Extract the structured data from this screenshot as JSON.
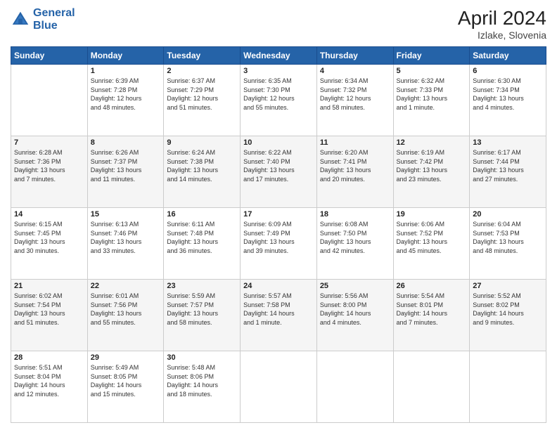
{
  "header": {
    "logo_line1": "General",
    "logo_line2": "Blue",
    "month_year": "April 2024",
    "location": "Izlake, Slovenia"
  },
  "weekdays": [
    "Sunday",
    "Monday",
    "Tuesday",
    "Wednesday",
    "Thursday",
    "Friday",
    "Saturday"
  ],
  "weeks": [
    [
      {
        "day": "",
        "info": ""
      },
      {
        "day": "1",
        "info": "Sunrise: 6:39 AM\nSunset: 7:28 PM\nDaylight: 12 hours\nand 48 minutes."
      },
      {
        "day": "2",
        "info": "Sunrise: 6:37 AM\nSunset: 7:29 PM\nDaylight: 12 hours\nand 51 minutes."
      },
      {
        "day": "3",
        "info": "Sunrise: 6:35 AM\nSunset: 7:30 PM\nDaylight: 12 hours\nand 55 minutes."
      },
      {
        "day": "4",
        "info": "Sunrise: 6:34 AM\nSunset: 7:32 PM\nDaylight: 12 hours\nand 58 minutes."
      },
      {
        "day": "5",
        "info": "Sunrise: 6:32 AM\nSunset: 7:33 PM\nDaylight: 13 hours\nand 1 minute."
      },
      {
        "day": "6",
        "info": "Sunrise: 6:30 AM\nSunset: 7:34 PM\nDaylight: 13 hours\nand 4 minutes."
      }
    ],
    [
      {
        "day": "7",
        "info": "Sunrise: 6:28 AM\nSunset: 7:36 PM\nDaylight: 13 hours\nand 7 minutes."
      },
      {
        "day": "8",
        "info": "Sunrise: 6:26 AM\nSunset: 7:37 PM\nDaylight: 13 hours\nand 11 minutes."
      },
      {
        "day": "9",
        "info": "Sunrise: 6:24 AM\nSunset: 7:38 PM\nDaylight: 13 hours\nand 14 minutes."
      },
      {
        "day": "10",
        "info": "Sunrise: 6:22 AM\nSunset: 7:40 PM\nDaylight: 13 hours\nand 17 minutes."
      },
      {
        "day": "11",
        "info": "Sunrise: 6:20 AM\nSunset: 7:41 PM\nDaylight: 13 hours\nand 20 minutes."
      },
      {
        "day": "12",
        "info": "Sunrise: 6:19 AM\nSunset: 7:42 PM\nDaylight: 13 hours\nand 23 minutes."
      },
      {
        "day": "13",
        "info": "Sunrise: 6:17 AM\nSunset: 7:44 PM\nDaylight: 13 hours\nand 27 minutes."
      }
    ],
    [
      {
        "day": "14",
        "info": "Sunrise: 6:15 AM\nSunset: 7:45 PM\nDaylight: 13 hours\nand 30 minutes."
      },
      {
        "day": "15",
        "info": "Sunrise: 6:13 AM\nSunset: 7:46 PM\nDaylight: 13 hours\nand 33 minutes."
      },
      {
        "day": "16",
        "info": "Sunrise: 6:11 AM\nSunset: 7:48 PM\nDaylight: 13 hours\nand 36 minutes."
      },
      {
        "day": "17",
        "info": "Sunrise: 6:09 AM\nSunset: 7:49 PM\nDaylight: 13 hours\nand 39 minutes."
      },
      {
        "day": "18",
        "info": "Sunrise: 6:08 AM\nSunset: 7:50 PM\nDaylight: 13 hours\nand 42 minutes."
      },
      {
        "day": "19",
        "info": "Sunrise: 6:06 AM\nSunset: 7:52 PM\nDaylight: 13 hours\nand 45 minutes."
      },
      {
        "day": "20",
        "info": "Sunrise: 6:04 AM\nSunset: 7:53 PM\nDaylight: 13 hours\nand 48 minutes."
      }
    ],
    [
      {
        "day": "21",
        "info": "Sunrise: 6:02 AM\nSunset: 7:54 PM\nDaylight: 13 hours\nand 51 minutes."
      },
      {
        "day": "22",
        "info": "Sunrise: 6:01 AM\nSunset: 7:56 PM\nDaylight: 13 hours\nand 55 minutes."
      },
      {
        "day": "23",
        "info": "Sunrise: 5:59 AM\nSunset: 7:57 PM\nDaylight: 13 hours\nand 58 minutes."
      },
      {
        "day": "24",
        "info": "Sunrise: 5:57 AM\nSunset: 7:58 PM\nDaylight: 14 hours\nand 1 minute."
      },
      {
        "day": "25",
        "info": "Sunrise: 5:56 AM\nSunset: 8:00 PM\nDaylight: 14 hours\nand 4 minutes."
      },
      {
        "day": "26",
        "info": "Sunrise: 5:54 AM\nSunset: 8:01 PM\nDaylight: 14 hours\nand 7 minutes."
      },
      {
        "day": "27",
        "info": "Sunrise: 5:52 AM\nSunset: 8:02 PM\nDaylight: 14 hours\nand 9 minutes."
      }
    ],
    [
      {
        "day": "28",
        "info": "Sunrise: 5:51 AM\nSunset: 8:04 PM\nDaylight: 14 hours\nand 12 minutes."
      },
      {
        "day": "29",
        "info": "Sunrise: 5:49 AM\nSunset: 8:05 PM\nDaylight: 14 hours\nand 15 minutes."
      },
      {
        "day": "30",
        "info": "Sunrise: 5:48 AM\nSunset: 8:06 PM\nDaylight: 14 hours\nand 18 minutes."
      },
      {
        "day": "",
        "info": ""
      },
      {
        "day": "",
        "info": ""
      },
      {
        "day": "",
        "info": ""
      },
      {
        "day": "",
        "info": ""
      }
    ]
  ]
}
